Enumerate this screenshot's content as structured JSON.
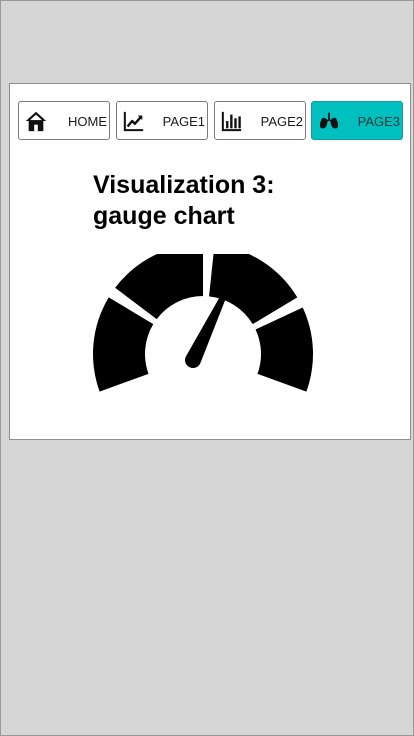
{
  "nav": {
    "tabs": [
      {
        "label": "HOME",
        "icon": "home-icon",
        "active": false
      },
      {
        "label": "PAGE1",
        "icon": "line-chart-icon",
        "active": false
      },
      {
        "label": "PAGE2",
        "icon": "bar-chart-icon",
        "active": false
      },
      {
        "label": "PAGE3",
        "icon": "lungs-icon",
        "active": true
      }
    ],
    "active_color": "#00bfbf"
  },
  "main": {
    "title": "Visualization 3: gauge chart"
  },
  "gauge": {
    "icon": "gauge-icon",
    "segments": 4,
    "needle_level": 0.6
  }
}
